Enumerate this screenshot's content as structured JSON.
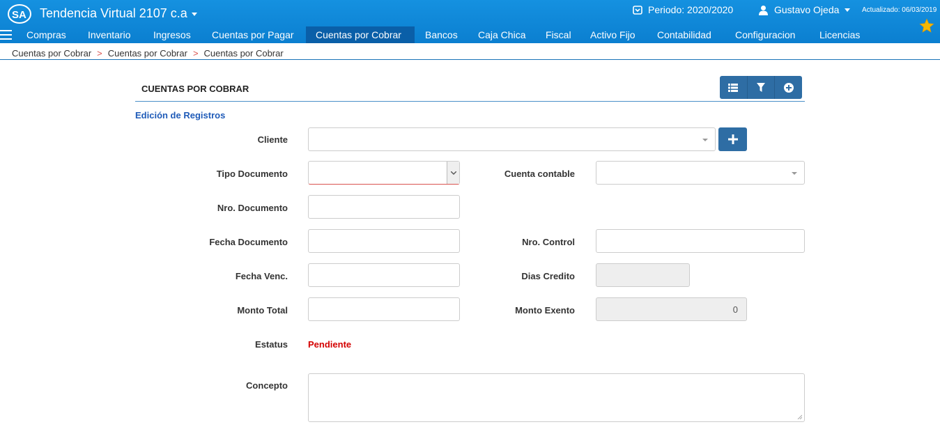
{
  "app": {
    "title": "Tendencia Virtual 2107 c.a",
    "periodo": "Periodo: 2020/2020",
    "user": "Gustavo Ojeda",
    "updated": "Actualizado: 06/03/2019"
  },
  "nav": {
    "items": [
      {
        "label": "Compras"
      },
      {
        "label": "Inventario"
      },
      {
        "label": "Ingresos"
      },
      {
        "label": "Cuentas por Pagar"
      },
      {
        "label": "Cuentas por Cobrar"
      },
      {
        "label": "Bancos"
      },
      {
        "label": "Caja Chica"
      },
      {
        "label": "Fiscal"
      },
      {
        "label": "Activo Fijo"
      },
      {
        "label": "Contabilidad"
      },
      {
        "label": "Configuracion"
      },
      {
        "label": "Licencias"
      }
    ],
    "active": "Cuentas por Cobrar"
  },
  "breadcrumb": [
    "Cuentas por Cobrar",
    "Cuentas por Cobrar",
    "Cuentas por Cobrar"
  ],
  "panel": {
    "title": "CUENTAS POR COBRAR",
    "subtitle": "Edición de Registros"
  },
  "form": {
    "cliente_label": "Cliente",
    "cliente_value": "",
    "tipo_documento_label": "Tipo Documento",
    "tipo_documento_value": "",
    "cuenta_contable_label": "Cuenta contable",
    "cuenta_contable_value": "",
    "nro_documento_label": "Nro. Documento",
    "nro_documento_value": "",
    "fecha_documento_label": "Fecha Documento",
    "fecha_documento_value": "",
    "nro_control_label": "Nro. Control",
    "nro_control_value": "",
    "fecha_venc_label": "Fecha Venc.",
    "fecha_venc_value": "",
    "dias_credito_label": "Dias Credito",
    "dias_credito_value": "",
    "monto_total_label": "Monto Total",
    "monto_total_value": "",
    "monto_exento_label": "Monto Exento",
    "monto_exento_value": "0",
    "estatus_label": "Estatus",
    "estatus_value": "Pendiente",
    "concepto_label": "Concepto",
    "concepto_value": ""
  },
  "colors": {
    "topbar": "#0b7fd0",
    "nav_active": "#0a5fa8",
    "button": "#2e6da4",
    "status": "#d40000",
    "subtitle": "#1f5bb8"
  }
}
